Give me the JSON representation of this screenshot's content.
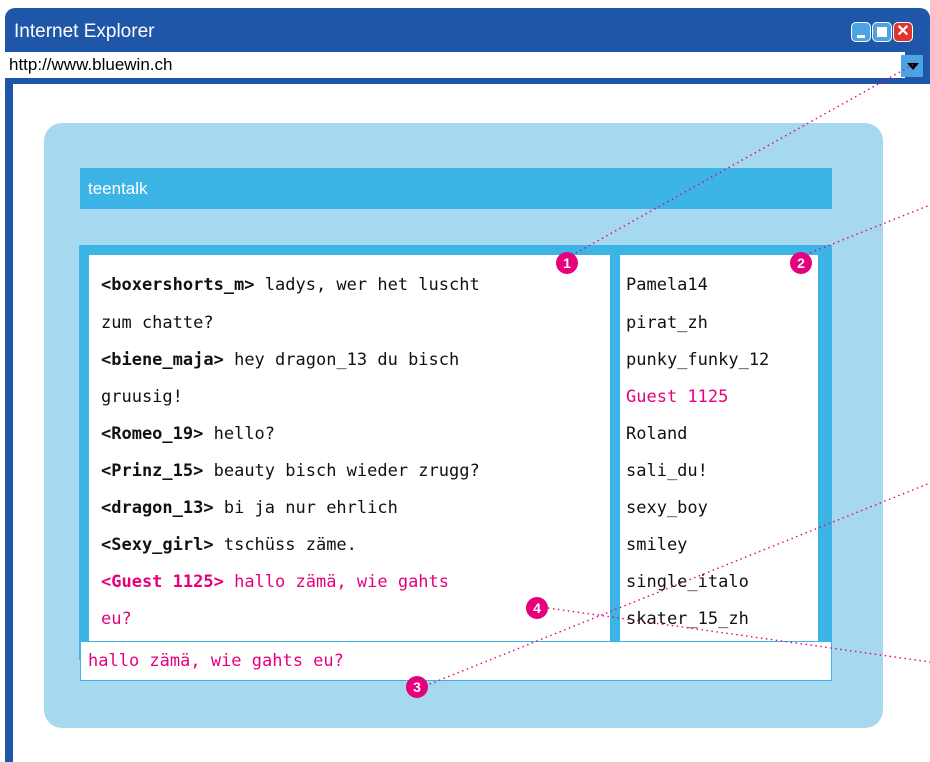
{
  "window": {
    "title": "Internet Explorer",
    "close_glyph": "✕",
    "controls": [
      "minimize-icon",
      "maximize-icon",
      "close-icon"
    ]
  },
  "address_bar": {
    "url": "http://www.bluewin.ch"
  },
  "chat": {
    "room_name": "teentalk",
    "messages": [
      {
        "user": "<boxershorts_m>",
        "text": "ladys, wer het luscht",
        "cont": "zum chatte?"
      },
      {
        "user": "<biene_maja>",
        "text": "hey dragon_13 du bisch",
        "cont": "gruusig!"
      },
      {
        "user": "<Romeo_19>",
        "text": "hello?"
      },
      {
        "user": "<Prinz_15>",
        "text": "beauty bisch wieder zrugg?"
      },
      {
        "user": "<dragon_13>",
        "text": "bi ja nur ehrlich"
      },
      {
        "user": "<Sexy_girl>",
        "text": "tschüss zäme."
      },
      {
        "user": "<Guest 1125>",
        "text": "hallo zämä, wie gahts",
        "cont": "eu?",
        "own": true
      }
    ],
    "users": [
      "Pamela14",
      "pirat_zh",
      "punky_funky_12",
      "Guest 1125",
      "Roland",
      "sali_du!",
      "sexy_boy",
      "smiley",
      "single_italo",
      "skater_15_zh"
    ],
    "input_value": "hallo zämä, wie gahts eu?"
  },
  "annotations": {
    "markers": [
      "1",
      "2",
      "3",
      "4"
    ]
  },
  "colors": {
    "titlebar": "#1f56a8",
    "panel": "#a6d8f0",
    "frame": "#3cb5e6",
    "highlight": "#e6007e"
  }
}
